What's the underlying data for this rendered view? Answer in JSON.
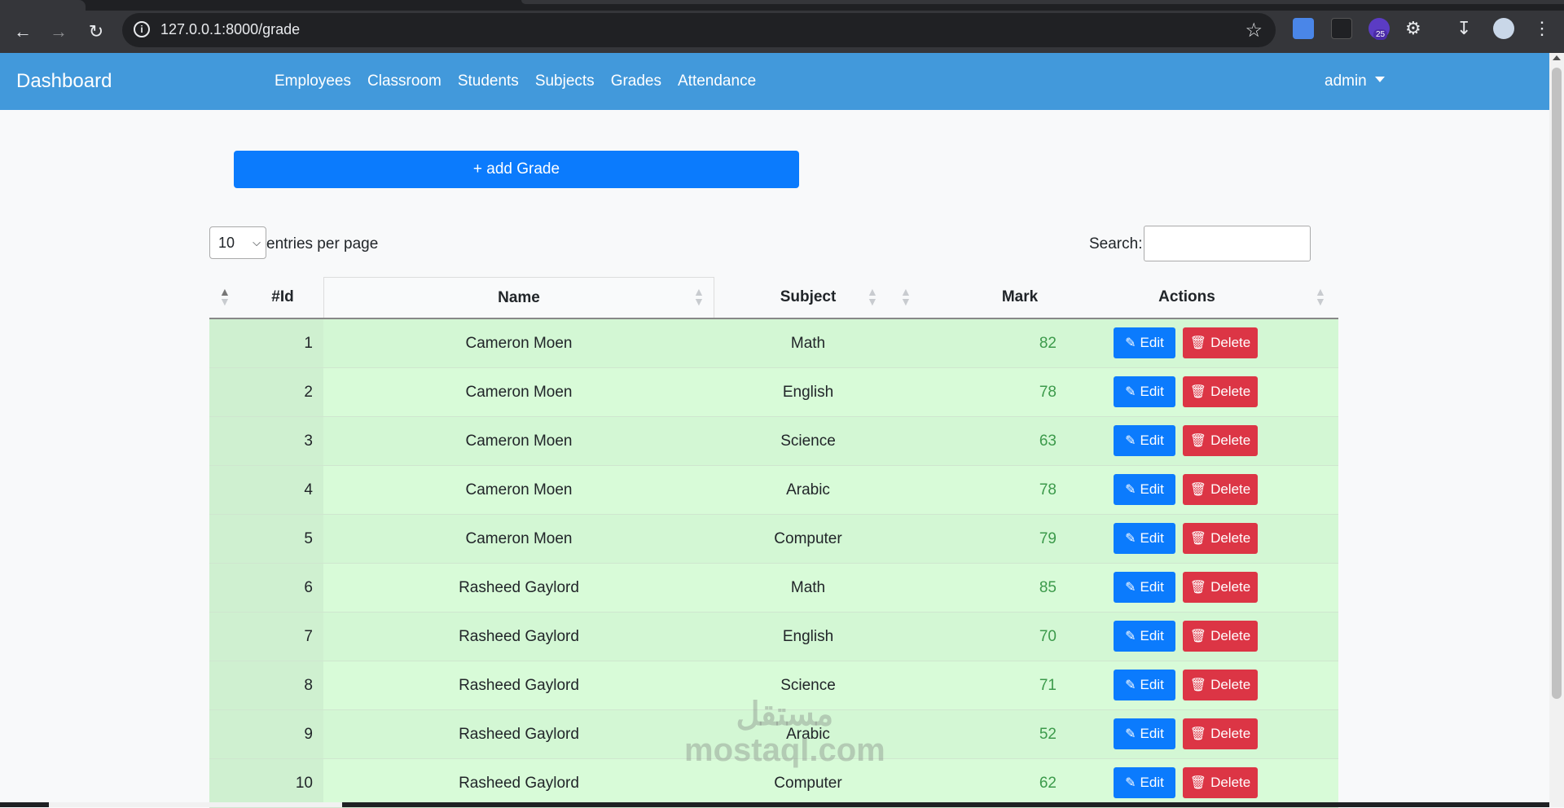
{
  "browser": {
    "url": "127.0.0.1:8000/grade",
    "extension_badge": "25"
  },
  "navbar": {
    "brand": "Dashboard",
    "links": [
      "Employees",
      "Classroom",
      "Students",
      "Subjects",
      "Grades",
      "Attendance"
    ],
    "user": "admin"
  },
  "add_button_label": "+ add Grade",
  "controls": {
    "entries_value": "10",
    "entries_label": "entries per page",
    "search_label": "Search:"
  },
  "table": {
    "headers": {
      "id": "#Id",
      "name": "Name",
      "subject": "Subject",
      "mark": "Mark",
      "actions": "Actions"
    },
    "edit_label": "Edit",
    "delete_label": "Delete",
    "rows": [
      {
        "id": "1",
        "name": "Cameron Moen",
        "subject": "Math",
        "mark": "82"
      },
      {
        "id": "2",
        "name": "Cameron Moen",
        "subject": "English",
        "mark": "78"
      },
      {
        "id": "3",
        "name": "Cameron Moen",
        "subject": "Science",
        "mark": "63"
      },
      {
        "id": "4",
        "name": "Cameron Moen",
        "subject": "Arabic",
        "mark": "78"
      },
      {
        "id": "5",
        "name": "Cameron Moen",
        "subject": "Computer",
        "mark": "79"
      },
      {
        "id": "6",
        "name": "Rasheed Gaylord",
        "subject": "Math",
        "mark": "85"
      },
      {
        "id": "7",
        "name": "Rasheed Gaylord",
        "subject": "English",
        "mark": "70"
      },
      {
        "id": "8",
        "name": "Rasheed Gaylord",
        "subject": "Science",
        "mark": "71"
      },
      {
        "id": "9",
        "name": "Rasheed Gaylord",
        "subject": "Arabic",
        "mark": "52"
      },
      {
        "id": "10",
        "name": "Rasheed Gaylord",
        "subject": "Computer",
        "mark": "62"
      }
    ]
  },
  "watermark": {
    "line1": "مستقل",
    "line2": "mostaql.com"
  },
  "colors": {
    "navbar": "#4299db",
    "primary": "#0b7bfd",
    "danger": "#dc3545",
    "row": "#d8fbd8",
    "mark": "#3c9a4b"
  }
}
